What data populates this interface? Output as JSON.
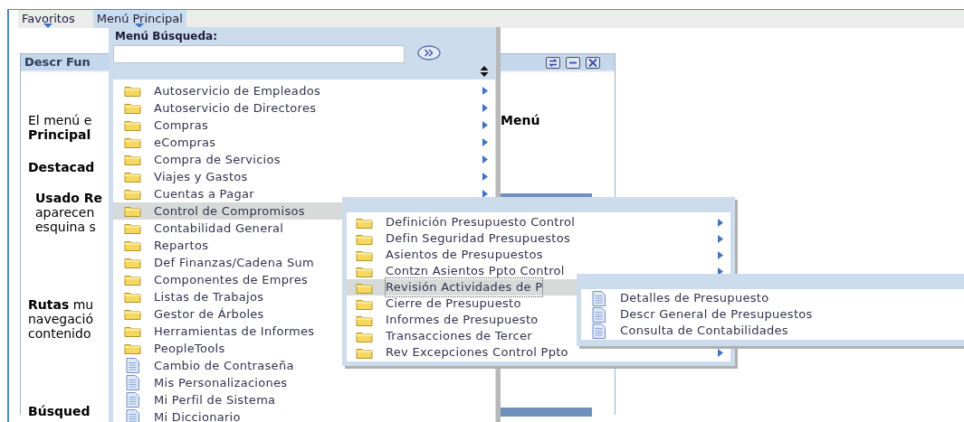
{
  "nav": [
    {
      "label": "Favoritos",
      "selected": false
    },
    {
      "label": "Menú Principal",
      "selected": true
    }
  ],
  "panel": {
    "title": "Descr Fun",
    "side_text": "Menú",
    "paragraphs": [
      {
        "lines": [
          {
            "text": "El menú e",
            "bold": false
          },
          {
            "text": "Principal",
            "bold": true
          }
        ]
      },
      {
        "lines": [
          {
            "text": "Destacad",
            "bold": true
          }
        ]
      },
      {
        "lines": [
          {
            "text": "Usado Re",
            "bold": true
          },
          {
            "text": "aparecen",
            "bold": false
          },
          {
            "text": "esquina s",
            "bold": false
          }
        ]
      },
      {
        "lines": [
          {
            "text": "**Rutas** mu",
            "bold": false
          },
          {
            "text": "navegació",
            "bold": false
          },
          {
            "text": "contenido",
            "bold": false
          }
        ]
      },
      {
        "lines": [
          {
            "text": "Búsqued",
            "bold": true
          }
        ]
      }
    ]
  },
  "menu": {
    "search_label": "Menú Búsqueda:",
    "items": [
      {
        "label": "Autoservicio de Empleados",
        "kind": "folder",
        "arrow": true,
        "selected": false
      },
      {
        "label": "Autoservicio de Directores",
        "kind": "folder",
        "arrow": true,
        "selected": false
      },
      {
        "label": "Compras",
        "kind": "folder",
        "arrow": true,
        "selected": false
      },
      {
        "label": "eCompras",
        "kind": "folder",
        "arrow": true,
        "selected": false
      },
      {
        "label": "Compra de Servicios",
        "kind": "folder",
        "arrow": true,
        "selected": false
      },
      {
        "label": "Viajes y Gastos",
        "kind": "folder",
        "arrow": true,
        "selected": false
      },
      {
        "label": "Cuentas a Pagar",
        "kind": "folder",
        "arrow": true,
        "selected": false
      },
      {
        "label": "Control de Compromisos",
        "kind": "folder",
        "selected": true
      },
      {
        "label": "Contabilidad General",
        "kind": "folder",
        "selected": false
      },
      {
        "label": "Repartos",
        "kind": "folder",
        "selected": false
      },
      {
        "label": "Def Finanzas/Cadena Sum",
        "kind": "folder",
        "selected": false
      },
      {
        "label": "Componentes de Empres",
        "kind": "folder",
        "selected": false
      },
      {
        "label": "Listas de Trabajos",
        "kind": "folder",
        "selected": false
      },
      {
        "label": "Gestor de Árboles",
        "kind": "folder",
        "selected": false
      },
      {
        "label": "Herramientas de Informes",
        "kind": "folder",
        "selected": false
      },
      {
        "label": "PeopleTools",
        "kind": "folder",
        "selected": false
      },
      {
        "label": "Cambio de Contraseña",
        "kind": "page",
        "selected": false
      },
      {
        "label": "Mis Personalizaciones",
        "kind": "page",
        "arrow": false,
        "selected": false
      },
      {
        "label": "Mi Perfil de Sistema",
        "kind": "page",
        "arrow": false,
        "selected": false
      },
      {
        "label": "Mi Diccionario",
        "kind": "page",
        "arrow": false,
        "selected": false
      }
    ]
  },
  "submenu": {
    "items": [
      {
        "label": "Definición Presupuesto Control",
        "kind": "folder",
        "arrow": true,
        "selected": false
      },
      {
        "label": "Defin Seguridad Presupuestos",
        "kind": "folder",
        "arrow": true,
        "selected": false
      },
      {
        "label": "Asientos de Presupuestos",
        "kind": "folder",
        "arrow": true,
        "selected": false
      },
      {
        "label": "Contzn Asientos Ppto Control",
        "kind": "folder",
        "arrow": true,
        "selected": false
      },
      {
        "label": "Revisión Actividades de P",
        "kind": "folder",
        "selected": true
      },
      {
        "label": "Cierre de Presupuesto",
        "kind": "folder",
        "selected": false
      },
      {
        "label": "Informes de Presupuesto",
        "kind": "folder",
        "selected": false
      },
      {
        "label": "Transacciones de Tercer",
        "kind": "folder",
        "selected": false
      },
      {
        "label": "Rev Excepciones Control Ppto",
        "kind": "folder",
        "arrow": true,
        "selected": false
      }
    ]
  },
  "submenu_2": {
    "items": [
      {
        "label": "Detalles de Presupuesto",
        "kind": "page",
        "selected": false
      },
      {
        "label": "Descr General de Presupuestos",
        "kind": "page",
        "selected": false
      },
      {
        "label": "Consulta de Contabilidades",
        "kind": "page",
        "selected": false
      }
    ]
  }
}
